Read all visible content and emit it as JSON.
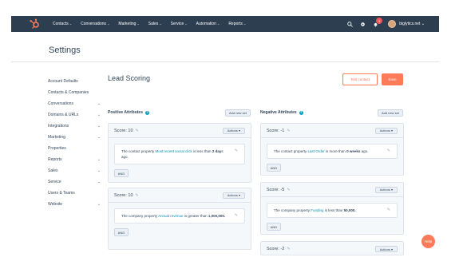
{
  "topnav": {
    "items": [
      "Contacts",
      "Conversations",
      "Marketing",
      "Sales",
      "Service",
      "Automation",
      "Reports"
    ],
    "account": "biglytics.net",
    "notification_count": "3",
    "colors": {
      "bar": "#2d3e50",
      "logo": "#ff7a59"
    }
  },
  "settings": {
    "title": "Settings"
  },
  "sidebar": {
    "items": [
      {
        "label": "Account Defaults",
        "expandable": false
      },
      {
        "label": "Contacts & Companies",
        "expandable": false
      },
      {
        "label": "Conversations",
        "expandable": true
      },
      {
        "label": "Domains & URLs",
        "expandable": true
      },
      {
        "label": "Integrations",
        "expandable": true
      },
      {
        "label": "Marketing",
        "expandable": true
      },
      {
        "label": "Properties",
        "expandable": false
      },
      {
        "label": "Reports",
        "expandable": true
      },
      {
        "label": "Sales",
        "expandable": true
      },
      {
        "label": "Service",
        "expandable": true
      },
      {
        "label": "Users & Teams",
        "expandable": false
      },
      {
        "label": "Website",
        "expandable": true
      }
    ]
  },
  "main": {
    "title": "Lead Scoring",
    "test_contact": "Test contact",
    "save": "Save",
    "positive": {
      "heading": "Positive Attributes",
      "add_new_set": "Add new set",
      "cards": [
        {
          "score": "Score: 10",
          "actions": "Actions",
          "pre": "The contact property ",
          "link": "Most recent social click",
          "mid": " is less than ",
          "bold": "2 day",
          "post": "s ago.",
          "and": "AND"
        },
        {
          "score": "Score: 10",
          "actions": "Actions",
          "pre": "The company property ",
          "link": "Annual revenue",
          "mid": " is greater than ",
          "bold": "1,000,000.",
          "post": "",
          "and": "AND"
        }
      ]
    },
    "negative": {
      "heading": "Negative Attributes",
      "add_new_set": "Add new set",
      "cards": [
        {
          "score": "Score: -1",
          "actions": "Actions",
          "pre": "The contact property ",
          "link": "Last Order",
          "mid": " is more than ",
          "bold": "0 weeks",
          "post": " ago.",
          "and": "AND"
        },
        {
          "score": "Score: -5",
          "actions": "Actions",
          "pre": "The company property ",
          "link": "Funding",
          "mid": " is less than ",
          "bold": "50,000.",
          "post": "",
          "and": "AND"
        },
        {
          "score": "Score: -2",
          "actions": "Actions"
        }
      ]
    }
  },
  "help": "Help",
  "colors": {
    "accent": "#ff7a59",
    "link": "#0091ae",
    "text": "#33475b"
  }
}
